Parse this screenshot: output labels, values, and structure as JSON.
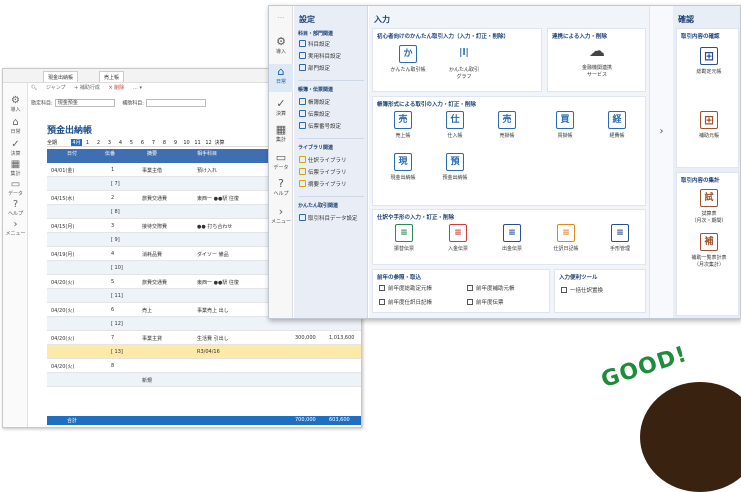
{
  "back": {
    "tabs": [
      "現金出納帳",
      "売上帳"
    ],
    "toolbar": [
      "ジャンプ",
      "+ 補助行成",
      "× 削除",
      "… ▾"
    ],
    "filter_label1": "勘定科目:",
    "filter_val1": "現金預金",
    "filter_label2": "補助科目:",
    "title": "預金出納帳",
    "months_label": "期間:",
    "months": [
      "全期",
      "4月",
      "1",
      "2",
      "3",
      "4",
      "5",
      "6",
      "7",
      "8",
      "9",
      "10",
      "11",
      "12",
      "決算"
    ],
    "thead": [
      "日付",
      "伝番",
      "摘要",
      "相手科目",
      "相手補助"
    ],
    "rows": [
      {
        "d": "04/01(金)",
        "n": "1",
        "k": "事業主借",
        "a": "預け入れ",
        "v": "",
        "b": ""
      },
      {
        "d": "",
        "n": "[ 7]",
        "k": "",
        "a": "",
        "v": "",
        "b": ""
      },
      {
        "d": "04/15(水)",
        "n": "2",
        "k": "旅費交通費",
        "a": "東西一 ●●駅 往復",
        "v": "",
        "b": ""
      },
      {
        "d": "",
        "n": "[ 8]",
        "k": "",
        "a": "",
        "v": "",
        "b": ""
      },
      {
        "d": "04/15(月)",
        "n": "3",
        "k": "接待交際費",
        "a": "●● 打ち合わせ",
        "v": "",
        "b": ""
      },
      {
        "d": "",
        "n": "[ 9]",
        "k": "",
        "a": "",
        "v": "",
        "b": ""
      },
      {
        "d": "04/19(月)",
        "n": "4",
        "k": "消耗品費",
        "a": "ダイソー 備品",
        "v": "",
        "b": ""
      },
      {
        "d": "",
        "n": "[ 10]",
        "k": "",
        "a": "",
        "v": "",
        "b": ""
      },
      {
        "d": "04/20(火)",
        "n": "5",
        "k": "旅費交通費",
        "a": "東西一 ●●駅 往復",
        "v": "",
        "b": ""
      },
      {
        "d": "",
        "n": "[ 11]",
        "k": "",
        "a": "",
        "v": "",
        "b": ""
      },
      {
        "d": "04/20(火)",
        "n": "6",
        "k": "売上",
        "a": "事業売上 出し",
        "v": "",
        "b": ""
      },
      {
        "d": "",
        "n": "[ 12]",
        "k": "",
        "a": "",
        "v": "",
        "b": ""
      },
      {
        "d": "04/20(火)",
        "n": "7",
        "k": "事業主貸",
        "a": "生活費 引出し",
        "v": "300,000",
        "b": "1,013,600"
      },
      {
        "d": "",
        "n": "[ 13]",
        "k": "",
        "a": "R3/04/16",
        "v": "",
        "b": ""
      },
      {
        "d": "04/20(火)",
        "n": "8",
        "k": "",
        "a": "",
        "v": "",
        "b": ""
      },
      {
        "d": "",
        "n": "",
        "k": "新規",
        "a": "",
        "v": "",
        "b": ""
      }
    ],
    "sum": [
      "合計",
      "",
      "",
      "",
      "合計",
      "700,000",
      "603,600"
    ],
    "side": [
      "導入",
      "日常",
      "決算",
      "集計",
      "データ",
      "ヘルプ",
      "メニュー"
    ]
  },
  "nav": [
    "導入",
    "日常",
    "決算",
    "集計",
    "データ",
    "ヘルプ",
    "メニュー"
  ],
  "settings": {
    "title": "設定",
    "groups": [
      {
        "label": "科目・部門関連",
        "items": [
          "科目設定",
          "実用科目設定",
          "部門設定"
        ]
      },
      {
        "label": "帳簿・伝票関連",
        "items": [
          "帳簿設定",
          "伝票設定",
          "伝票番号設定"
        ]
      },
      {
        "label": "ライブラリ関連",
        "items": [
          "仕訳ライブラリ",
          "伝票ライブラリ",
          "摘要ライブラリ"
        ]
      },
      {
        "label": "かんたん取引関連",
        "items": [
          "取引科目データ設定"
        ]
      }
    ]
  },
  "input": {
    "title": "入力",
    "p1_label": "初心者向けのかんたん取引入力（入力・訂正・削除）",
    "p1_btns": [
      [
        "か",
        "かんたん取引帳"
      ],
      [
        "|l|",
        "かんたん取引\nグラフ"
      ]
    ],
    "p2_label": "連携による入力・削除",
    "p2_btn": [
      "☁",
      "金融機関連携\nサービス"
    ],
    "p3_label": "帳簿形式による取引の入力・訂正・削除",
    "p3_btns": [
      [
        "売",
        "売上帳"
      ],
      [
        "仕",
        "仕入帳"
      ],
      [
        "売",
        "売掛帳"
      ],
      [
        "買",
        "買掛帳"
      ],
      [
        "経",
        "経費帳"
      ],
      [
        "現",
        "現金出納帳"
      ],
      [
        "預",
        "預金出納帳"
      ]
    ],
    "p4_label": "仕訳や手形の入力・訂正・削除",
    "p4_btns": [
      [
        "≡",
        "振替伝票"
      ],
      [
        "≡",
        "入金伝票"
      ],
      [
        "≡",
        "出金伝票"
      ],
      [
        "≡",
        "仕訳日記帳"
      ],
      [
        "≡",
        "手形管理"
      ]
    ],
    "p5_label": "前年の参照・取込",
    "p5_items": [
      "前年度総勘定元帳",
      "前年度補助元帳",
      "前年度仕訳日記帳",
      "前年度伝票"
    ],
    "p6_label": "入力便利ツール",
    "p6_item": "一括仕訳置換"
  },
  "confirm": {
    "title": "確認",
    "p1_label": "取引内容の確認",
    "p1_btns": [
      "総勘定元帳",
      "補助元帳"
    ],
    "p2_label": "取引内容の集計",
    "p2_btns": [
      [
        "試",
        "試算表\n（月次・期間）"
      ],
      [
        "補",
        "補助一覧表計表\n（月次集計）"
      ]
    ]
  },
  "good": "GOOD!"
}
